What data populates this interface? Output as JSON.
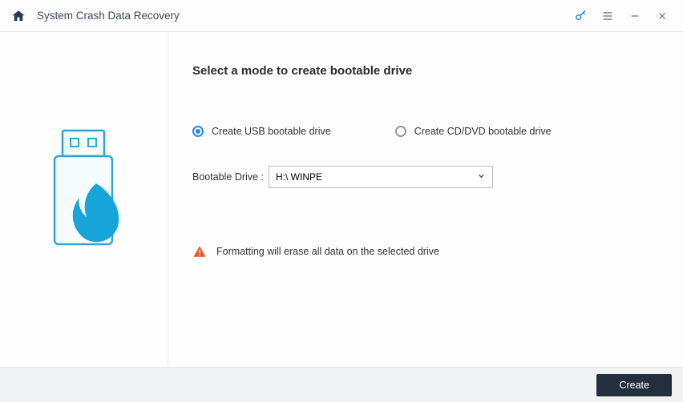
{
  "header": {
    "title": "System Crash Data Recovery"
  },
  "main": {
    "heading": "Select a mode to create bootable drive",
    "options": {
      "usb": "Create USB bootable drive",
      "cddvd": "Create CD/DVD bootable drive",
      "selected": "usb"
    },
    "drive_label": "Bootable Drive :",
    "drive_selected": "H:\\ WINPE",
    "warning_text": "Formatting will erase all data on the selected drive"
  },
  "footer": {
    "create_label": "Create"
  },
  "colors": {
    "accent": "#1f8de0",
    "warn": "#e55a2b",
    "btn_bg": "#232f3e"
  }
}
